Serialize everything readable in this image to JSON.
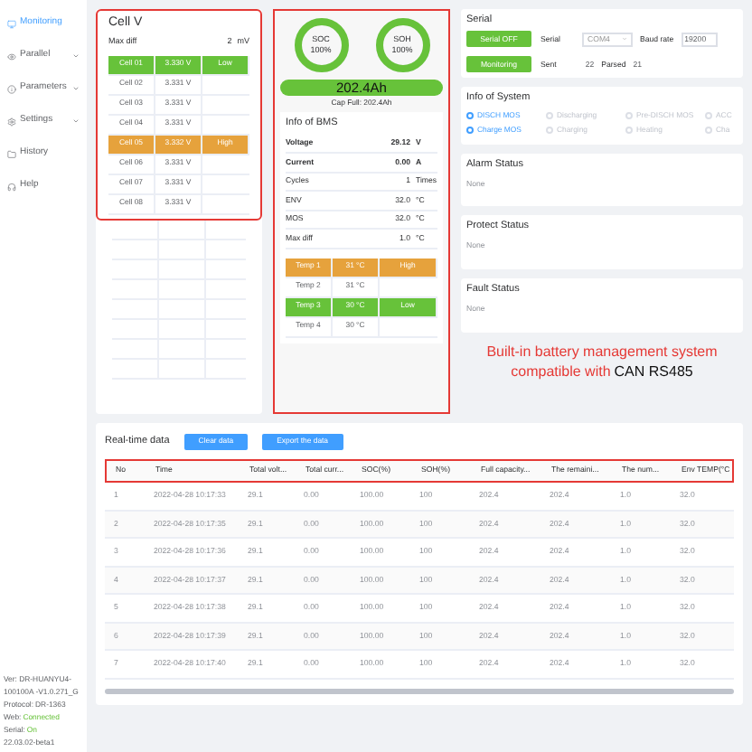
{
  "sidebar": {
    "items": [
      {
        "label": "Monitoring",
        "selected": true,
        "expandable": false
      },
      {
        "label": "Parallel",
        "selected": false,
        "expandable": true
      },
      {
        "label": "Parameters",
        "selected": false,
        "expandable": true
      },
      {
        "label": "Settings",
        "selected": false,
        "expandable": true
      },
      {
        "label": "History",
        "selected": false,
        "expandable": false
      },
      {
        "label": "Help",
        "selected": false,
        "expandable": false
      }
    ],
    "footer": {
      "version": "Ver: DR-HUANYU4-100100A -V1.0.271_G",
      "protocol_label": "Protocol:",
      "protocol": "DR-1363",
      "web_label": "Web:",
      "web": "Connected",
      "serial_label": "Serial:",
      "serial": "On",
      "build": "22.03.02-beta1"
    }
  },
  "cell_v": {
    "title": "Cell V",
    "max_diff_label": "Max diff",
    "max_diff": "2",
    "max_diff_unit": "mV",
    "cells": [
      {
        "name": "Cell 01",
        "value": "3.330 V",
        "flag": "Low",
        "kind": "low"
      },
      {
        "name": "Cell 02",
        "value": "3.331 V",
        "kind": "normal"
      },
      {
        "name": "Cell 03",
        "value": "3.331 V",
        "kind": "normal"
      },
      {
        "name": "Cell 04",
        "value": "3.331 V",
        "kind": "normal"
      },
      {
        "name": "Cell 05",
        "value": "3.332 V",
        "flag": "High",
        "kind": "high"
      },
      {
        "name": "Cell 06",
        "value": "3.331 V",
        "kind": "normal"
      },
      {
        "name": "Cell 07",
        "value": "3.331 V",
        "kind": "normal"
      },
      {
        "name": "Cell 08",
        "value": "3.331 V",
        "kind": "normal"
      }
    ]
  },
  "bms": {
    "gauges": [
      {
        "label": "SOC",
        "value": "100%",
        "level": 1
      },
      {
        "label": "SOH",
        "value": "100%",
        "level": 1
      }
    ],
    "capacity": "202.4Ah",
    "cap_full": "Cap Full: 202.4Ah",
    "info_title": "Info of BMS",
    "info": [
      {
        "name": "Voltage",
        "value": "29.12",
        "unit": "V",
        "bold": true
      },
      {
        "name": "Current",
        "value": "0.00",
        "unit": "A",
        "bold": true
      },
      {
        "name": "Cycles",
        "value": "1",
        "unit": "Times",
        "bold": false
      },
      {
        "name": "ENV",
        "value": "32.0",
        "unit": "°C",
        "bold": false
      },
      {
        "name": "MOS",
        "value": "32.0",
        "unit": "°C",
        "bold": false
      },
      {
        "name": "Max diff",
        "value": "1.0",
        "unit": "°C",
        "bold": false
      }
    ],
    "temps": [
      {
        "name": "Temp 1",
        "value": "31 °C",
        "flag": "High",
        "kind": "high"
      },
      {
        "name": "Temp 2",
        "value": "31 °C",
        "kind": "normal"
      },
      {
        "name": "Temp 3",
        "value": "30 °C",
        "flag": "Low",
        "kind": "low"
      },
      {
        "name": "Temp 4",
        "value": "30 °C",
        "kind": "normal"
      }
    ]
  },
  "serial": {
    "title": "Serial",
    "buttons": [
      "Serial OFF",
      "Monitoring"
    ],
    "port_label": "Serial",
    "port": "COM4",
    "baud_label": "Baud rate",
    "baud": "19200",
    "sent_label": "Sent",
    "sent": "22",
    "parsed_label": "Parsed",
    "parsed": "21"
  },
  "system": {
    "title": "Info of System",
    "rows": [
      [
        {
          "label": "DISCH MOS",
          "checked": true
        },
        {
          "label": "Discharging",
          "checked": false
        },
        {
          "label": "Pre-DISCH MOS",
          "checked": false
        },
        {
          "label": "ACC",
          "checked": false
        }
      ],
      [
        {
          "label": "Charge MOS",
          "checked": true
        },
        {
          "label": "Charging",
          "checked": false
        },
        {
          "label": "Heating",
          "checked": false
        },
        {
          "label": "Cha",
          "checked": false
        }
      ]
    ]
  },
  "statuses": [
    {
      "title": "Alarm Status",
      "value": "None"
    },
    {
      "title": "Protect Status",
      "value": "None"
    },
    {
      "title": "Fault Status",
      "value": "None"
    }
  ],
  "caption": {
    "line1": "Built-in battery management system",
    "line2_red": "compatible with",
    "line2_dark": "CAN RS485"
  },
  "realtime": {
    "title": "Real-time data",
    "buttons": [
      "Clear data",
      "Export the data"
    ],
    "columns": [
      "No",
      "Time",
      "Total volt...",
      "Total curr...",
      "SOC(%)",
      "SOH(%)",
      "Full capacity...",
      "The remaini...",
      "The num...",
      "Env TEMP(°C"
    ],
    "rows": [
      [
        "1",
        "2022-04-28 10:17:33",
        "29.1",
        "0.00",
        "100.00",
        "100",
        "202.4",
        "202.4",
        "1.0",
        "32.0"
      ],
      [
        "2",
        "2022-04-28 10:17:35",
        "29.1",
        "0.00",
        "100.00",
        "100",
        "202.4",
        "202.4",
        "1.0",
        "32.0"
      ],
      [
        "3",
        "2022-04-28 10:17:36",
        "29.1",
        "0.00",
        "100.00",
        "100",
        "202.4",
        "202.4",
        "1.0",
        "32.0"
      ],
      [
        "4",
        "2022-04-28 10:17:37",
        "29.1",
        "0.00",
        "100.00",
        "100",
        "202.4",
        "202.4",
        "1.0",
        "32.0"
      ],
      [
        "5",
        "2022-04-28 10:17:38",
        "29.1",
        "0.00",
        "100.00",
        "100",
        "202.4",
        "202.4",
        "1.0",
        "32.0"
      ],
      [
        "6",
        "2022-04-28 10:17:39",
        "29.1",
        "0.00",
        "100.00",
        "100",
        "202.4",
        "202.4",
        "1.0",
        "32.0"
      ],
      [
        "7",
        "2022-04-28 10:17:40",
        "29.1",
        "0.00",
        "100.00",
        "100",
        "202.4",
        "202.4",
        "1.0",
        "32.0"
      ]
    ]
  }
}
